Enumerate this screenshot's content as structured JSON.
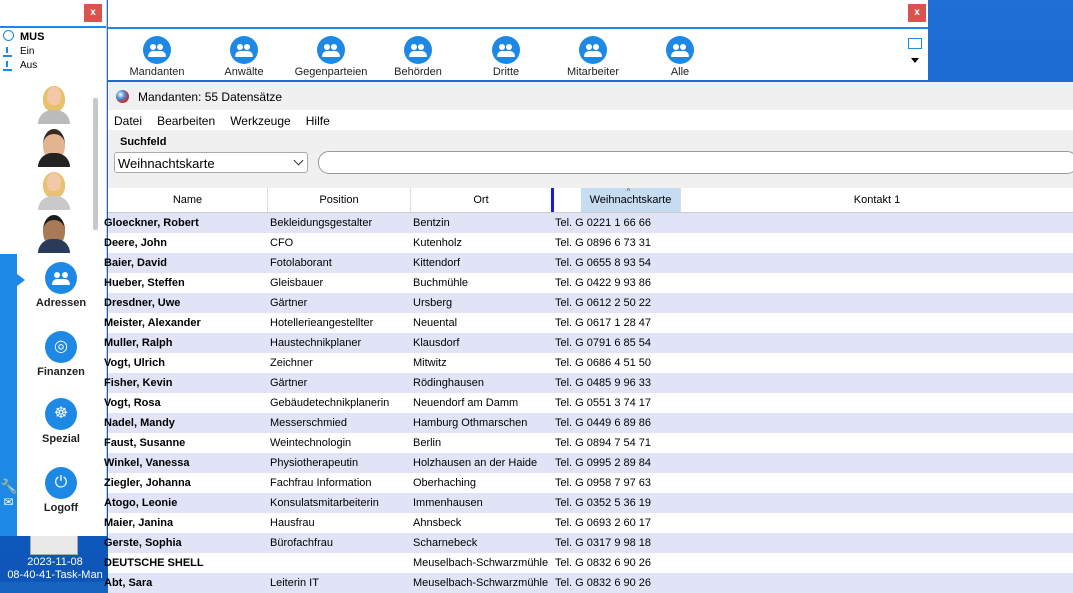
{
  "desktop": {
    "clock_date": "2023-11-08",
    "clock_file": "08-40-41-Task-Man"
  },
  "left_window": {
    "close_label": "x",
    "status_title": "MUS",
    "status_on": "Ein",
    "status_off": "Aus",
    "nav": [
      {
        "label": "Adressen",
        "icon": "people-icon"
      },
      {
        "label": "Finanzen",
        "icon": "coins-icon"
      },
      {
        "label": "Spezial",
        "icon": "helm-icon"
      },
      {
        "label": "Logoff",
        "icon": "power-icon"
      }
    ]
  },
  "top_window": {
    "close_label": "x",
    "buttons": [
      {
        "label": "Mandanten"
      },
      {
        "label": "Anwälte"
      },
      {
        "label": "Gegenparteien"
      },
      {
        "label": "Behörden"
      },
      {
        "label": "Dritte"
      },
      {
        "label": "Mitarbeiter"
      },
      {
        "label": "Alle"
      }
    ]
  },
  "main_window": {
    "title": "Mandanten: 55 Datensätze",
    "menu": [
      "Datei",
      "Bearbeiten",
      "Werkzeuge",
      "Hilfe"
    ],
    "search": {
      "label": "Suchfeld",
      "selected": "Weihnachtskarte",
      "query": ""
    },
    "columns": [
      "Name",
      "Position",
      "Ort",
      "Weihnachtskarte",
      "Kontakt 1"
    ],
    "rows": [
      {
        "name": "Gloeckner, Robert",
        "position": "Bekleidungsgestalter",
        "ort": "Bentzin",
        "tel": "Tel. G 0221 1 66 66"
      },
      {
        "name": "Deere, John",
        "position": "CFO",
        "ort": "Kutenholz",
        "tel": "Tel. G 0896 6 73 31"
      },
      {
        "name": "Baier, David",
        "position": "Fotolaborant",
        "ort": "Kittendorf",
        "tel": "Tel. G 0655 8 93 54"
      },
      {
        "name": "Hueber, Steffen",
        "position": "Gleisbauer",
        "ort": "Buchmühle",
        "tel": "Tel. G 0422 9 93 86"
      },
      {
        "name": "Dresdner, Uwe",
        "position": "Gärtner",
        "ort": "Ursberg",
        "tel": "Tel. G 0612 2 50 22"
      },
      {
        "name": "Meister, Alexander",
        "position": "Hotellerieangestellter",
        "ort": "Neuental",
        "tel": "Tel. G 0617 1 28 47"
      },
      {
        "name": "Muller, Ralph",
        "position": "Haustechnikplaner",
        "ort": "Klausdorf",
        "tel": "Tel. G 0791 6 85 54"
      },
      {
        "name": "Vogt, Ulrich",
        "position": "Zeichner",
        "ort": "Mitwitz",
        "tel": "Tel. G 0686 4 51 50"
      },
      {
        "name": "Fisher, Kevin",
        "position": "Gärtner",
        "ort": "Rödinghausen",
        "tel": "Tel. G 0485 9 96 33"
      },
      {
        "name": "Vogt, Rosa",
        "position": "Gebäudetechnikplanerin",
        "ort": "Neuendorf am Damm",
        "tel": "Tel. G 0551 3 74 17"
      },
      {
        "name": "Nadel, Mandy",
        "position": "Messerschmied",
        "ort": "Hamburg Othmarschen",
        "tel": "Tel. G 0449 6 89 86"
      },
      {
        "name": "Faust, Susanne",
        "position": "Weintechnologin",
        "ort": "Berlin",
        "tel": "Tel. G 0894 7 54 71"
      },
      {
        "name": "Winkel, Vanessa",
        "position": "Physiotherapeutin",
        "ort": "Holzhausen an der Haide",
        "tel": "Tel. G 0995 2 89 84"
      },
      {
        "name": "Ziegler, Johanna",
        "position": "Fachfrau Information",
        "ort": "Oberhaching",
        "tel": "Tel. G 0958 7 97 63"
      },
      {
        "name": "Atogo, Leonie",
        "position": "Konsulatsmitarbeiterin",
        "ort": "Immenhausen",
        "tel": "Tel. G 0352 5 36 19"
      },
      {
        "name": "Maier, Janina",
        "position": "Hausfrau",
        "ort": "Ahnsbeck",
        "tel": "Tel. G 0693 2 60 17"
      },
      {
        "name": "Gerste, Sophia",
        "position": "Bürofachfrau",
        "ort": "Scharnebeck",
        "tel": "Tel. G 0317 9 98 18"
      },
      {
        "name": "DEUTSCHE SHELL",
        "position": "",
        "ort": "Meuselbach-Schwarzmühle",
        "tel": "Tel. G 0832 6 90 26"
      },
      {
        "name": "Abt, Sara",
        "position": "Leiterin IT",
        "ort": "Meuselbach-Schwarzmühle",
        "tel": "Tel. G 0832 6 90 26"
      }
    ]
  },
  "colors": {
    "accent": "#1e88e5",
    "row_alt": "#e1e4f6",
    "sorted_header": "#c6dcf0",
    "close": "#d9534f"
  }
}
